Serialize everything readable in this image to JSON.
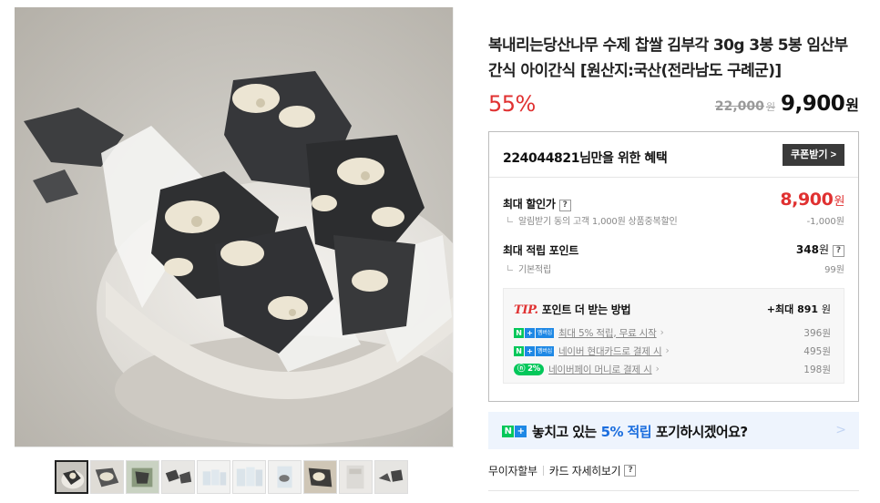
{
  "product": {
    "title": "복내리는당산나무 수제 찹쌀 김부각 30g 3봉 5봉 임산부 간식 아이간식 [원산지:국산(전라남도 구례군)]",
    "discount_rate": "55%",
    "original_price": "22,000",
    "original_unit": "원",
    "sale_price": "9,900",
    "sale_unit": "원"
  },
  "benefit": {
    "header": "224044821님만을 위한 혜택",
    "coupon_button": "쿠폰받기 >",
    "max_discount_label": "최대 할인가",
    "max_discount_price": "8,900",
    "max_discount_unit": "원",
    "max_discount_sub": "알림받기 동의 고객 1,000원 상품중복할인",
    "max_discount_sub_amount": "-1,000원",
    "max_point_label": "최대 적립 포인트",
    "max_point_value": "348",
    "max_point_unit": "원",
    "basic_point_label": "기본적립",
    "basic_point_value": "99원",
    "help_mark": "?"
  },
  "tip": {
    "tip_word": "TIP.",
    "title": "포인트 더 받는 방법",
    "max_prefix": "+최대",
    "max_value": "891",
    "max_unit": "원",
    "rows": [
      {
        "badge": "membership",
        "text": "최대 5% 적립, 무료 시작",
        "amount": "396원"
      },
      {
        "badge": "membership",
        "text": "네이버 현대카드로 결제 시",
        "amount": "495원"
      },
      {
        "badge": "pay",
        "badge_text": "2%",
        "text": "네이버페이 머니로 결제 시",
        "amount": "198원"
      }
    ],
    "badge_n": "N",
    "badge_plus": "+",
    "badge_membership": "멤버십"
  },
  "banner": {
    "text_before": "놓치고 있는",
    "highlight": "5% 적립",
    "text_after": "포기하시겠어요?",
    "arrow": ">"
  },
  "installment": {
    "label": "무이자할부",
    "card_link": "카드 자세히보기",
    "help_mark": "?"
  },
  "colors": {
    "accent_red": "#e03131",
    "naver_green": "#03c75a",
    "naver_blue": "#1e88e5",
    "banner_bg": "#eef4fd"
  }
}
